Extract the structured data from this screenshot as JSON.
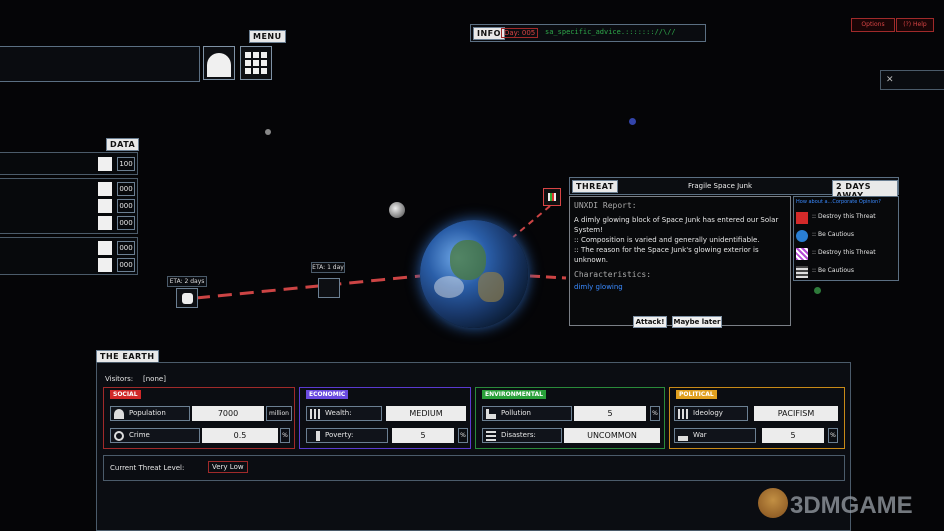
{
  "menu": {
    "label": "MENU"
  },
  "data_panel": {
    "label": "DATA",
    "rows": [
      {
        "icon": "tech-icon",
        "value": "100"
      },
      {
        "icon": "unit-a-icon",
        "value": "000"
      },
      {
        "icon": "unit-b-icon",
        "value": "000"
      },
      {
        "icon": "unit-c-icon",
        "value": "000"
      },
      {
        "icon": "unit-d-icon",
        "value": "000"
      },
      {
        "icon": "person-icon",
        "value": "000"
      }
    ]
  },
  "info_bar": {
    "label": "INFO",
    "day": "Day: 005",
    "advice": "sa_specific_advice.::::::://\\//"
  },
  "top_buttons": {
    "options": "Options",
    "help": "(?) Help"
  },
  "eta": {
    "far": "ETA: 2 days",
    "near": "ETA: 1 day"
  },
  "threat": {
    "label": "THREAT",
    "name": "Fragile Space Junk",
    "eta": "2 DAYS AWAY",
    "report_title": "UNXDI Report:",
    "report_lines": [
      "A dimly glowing block of Space Junk has entered our Solar System!",
      ":: Composition is varied and generally unidentifiable.",
      ":: The reason for the Space Junk's glowing exterior is unknown."
    ],
    "characteristics_label": "Characteristics:",
    "characteristic": "dimly glowing",
    "attack_button": "Attack!",
    "later_button": "Maybe later"
  },
  "opinions": {
    "title": "How about a...Corporate Opinion?",
    "items": [
      {
        "icon": "flag-icon",
        "text": ":: Destroy this Threat",
        "color": "#d42a2a"
      },
      {
        "icon": "globe-icon",
        "text": ":: Be Cautious",
        "color": "#2a7fd4"
      },
      {
        "icon": "pattern-icon",
        "text": ":: Destroy this Threat",
        "color": "#b54ad4"
      },
      {
        "icon": "stack-icon",
        "text": ":: Be Cautious",
        "color": "#dddddd"
      }
    ]
  },
  "earth": {
    "label": "THE EARTH",
    "visitors_label": "Visitors:",
    "visitors_value": "[none]",
    "categories": {
      "social": {
        "label": "SOCIAL",
        "color": "#d02828",
        "f1_label": "Population",
        "f1_value": "7000",
        "f1_unit": "million",
        "f2_label": "Crime",
        "f2_value": "0.5",
        "f2_unit": "%"
      },
      "economic": {
        "label": "ECONOMIC",
        "color": "#6a4ae0",
        "f1_label": "Wealth:",
        "f1_value": "MEDIUM",
        "f2_label": "Poverty:",
        "f2_value": "5",
        "f2_unit": "%"
      },
      "environmental": {
        "label": "ENVIRONMENTAL",
        "color": "#2aa03a",
        "f1_label": "Pollution",
        "f1_value": "5",
        "f1_unit": "%",
        "f2_label": "Disasters:",
        "f2_value": "UNCOMMON"
      },
      "political": {
        "label": "POLITICAL",
        "color": "#e0a020",
        "f1_label": "Ideology",
        "f1_value": "PACIFISM",
        "f2_label": "War",
        "f2_value": "5",
        "f2_unit": "%"
      }
    },
    "threat_level_label": "Current Threat Level:",
    "threat_level_value": "Very Low"
  },
  "watermark": "3DMGAME"
}
